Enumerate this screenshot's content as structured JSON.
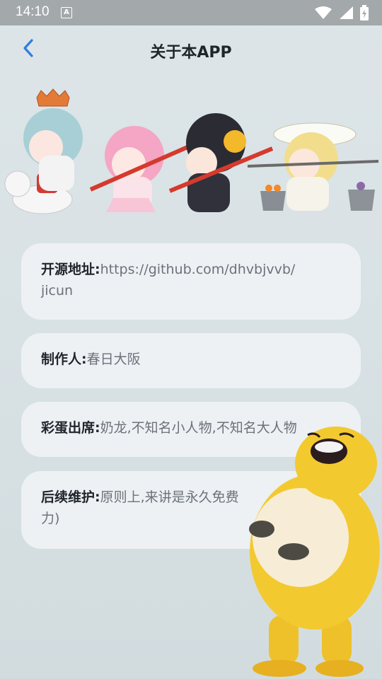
{
  "status_bar": {
    "time": "14:10",
    "indicator": "A",
    "icons": [
      "wifi-icon",
      "signal-icon",
      "battery-icon"
    ]
  },
  "header": {
    "title": "关于本APP",
    "back_icon": "chevron-left-icon"
  },
  "cards": [
    {
      "label": "开源地址:",
      "value": "https://github.com/dhvbjvvb/\njicun"
    },
    {
      "label": "制作人:",
      "value": "春日大阪"
    },
    {
      "label": "彩蛋出席:",
      "value": "奶龙,不知名小人物,不知名大人物"
    },
    {
      "label": "后续维护:",
      "value": "原则上,来讲是永久免费"
    },
    {
      "continuation": "力)"
    }
  ],
  "colors": {
    "accent": "#2f7de1",
    "status_bar": "#a3a8ab",
    "sticker": "#f2c42c"
  }
}
